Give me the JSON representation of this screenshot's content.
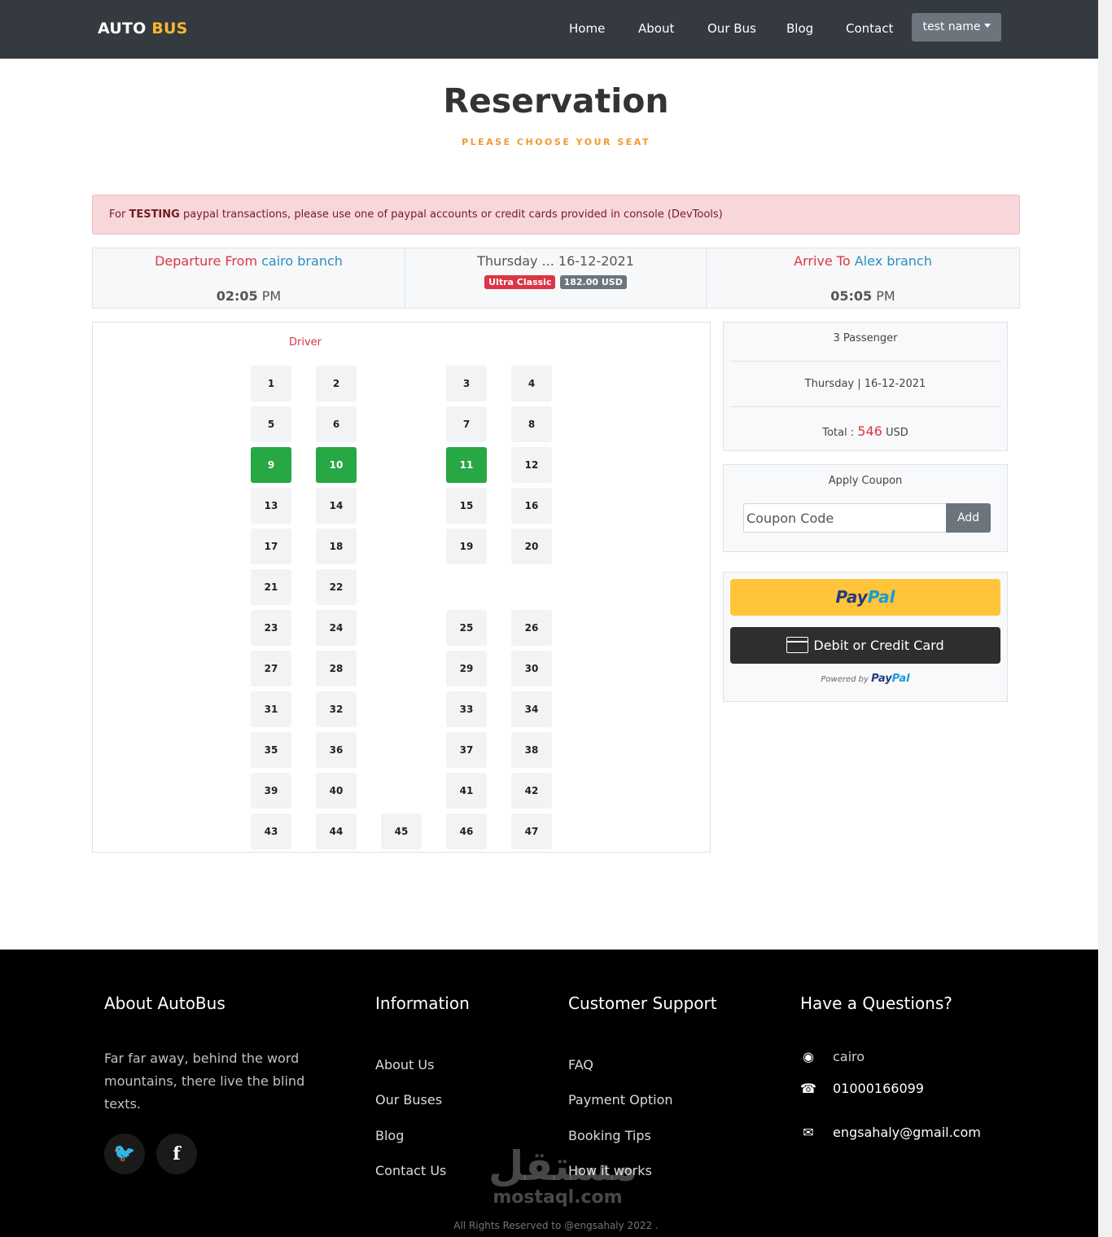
{
  "nav": {
    "brand_part1": "AUTO",
    "brand_part2": "BUS",
    "links": [
      "Home",
      "About",
      "Our Bus",
      "Blog",
      "Contact"
    ],
    "user": "test name"
  },
  "page": {
    "title": "Reservation",
    "subtitle": "PLEASE CHOOSE YOUR SEAT"
  },
  "alert": {
    "prefix": "For",
    "bold": "TESTING",
    "suffix": "paypal transactions, please use one of paypal accounts or credit cards provided in console (DevTools)"
  },
  "trip": {
    "departure_label": "Departure From",
    "departure_branch": "cairo branch",
    "departure_time": "02:05",
    "departure_period": "PM",
    "date": "Thursday ... 16-12-2021",
    "bus_class": "Ultra Classic",
    "price": "182.00 USD",
    "arrival_label": "Arrive To",
    "arrival_branch": "Alex branch",
    "arrival_time": "05:05",
    "arrival_period": "PM"
  },
  "seatmap": {
    "driver_label": "Driver",
    "rows": [
      [
        "1",
        "2",
        "",
        "3",
        "4"
      ],
      [
        "5",
        "6",
        "",
        "7",
        "8"
      ],
      [
        "9",
        "10",
        "",
        "11",
        "12"
      ],
      [
        "13",
        "14",
        "",
        "15",
        "16"
      ],
      [
        "17",
        "18",
        "",
        "19",
        "20"
      ],
      [
        "21",
        "22",
        "",
        "",
        ""
      ],
      [
        "23",
        "24",
        "",
        "25",
        "26"
      ],
      [
        "27",
        "28",
        "",
        "29",
        "30"
      ],
      [
        "31",
        "32",
        "",
        "33",
        "34"
      ],
      [
        "35",
        "36",
        "",
        "37",
        "38"
      ],
      [
        "39",
        "40",
        "",
        "41",
        "42"
      ],
      [
        "43",
        "44",
        "45",
        "46",
        "47"
      ]
    ],
    "selected": [
      "9",
      "10",
      "11"
    ],
    "selected_color": "#28a745"
  },
  "summary": {
    "passengers": "3 Passenger",
    "date": "Thursday | 16-12-2021",
    "total_label": "Total :",
    "total_value": "546",
    "total_currency": "USD"
  },
  "coupon": {
    "title": "Apply Coupon",
    "placeholder": "Coupon Code",
    "button": "Add"
  },
  "payment": {
    "paypal_part1": "Pay",
    "paypal_part2": "Pal",
    "card_button": "Debit or Credit Card",
    "powered_by": "Powered by",
    "powered_brand1": "Pay",
    "powered_brand2": "Pal"
  },
  "footer": {
    "about_heading": "About AutoBus",
    "about_text": "Far far away, behind the word mountains, there live the blind texts.",
    "social": [
      {
        "name": "twitter-icon",
        "glyph": "🐦"
      },
      {
        "name": "facebook-icon",
        "glyph": "f"
      }
    ],
    "info_heading": "Information",
    "info_links": [
      "About Us",
      "Our Buses",
      "Blog",
      "Contact Us"
    ],
    "support_heading": "Customer Support",
    "support_links": [
      "FAQ",
      "Payment Option",
      "Booking Tips",
      "How it works"
    ],
    "questions_heading": "Have a Questions?",
    "address": "cairo",
    "phone": "01000166099",
    "email": "engsahaly@gmail.com",
    "watermark_arabic": "مستقل",
    "watermark_latin": "mostaql.com",
    "copyright": "All Rights Reserved to @engsahaly 2022 ."
  },
  "colors": {
    "navbar": "#343a40",
    "accent": "#f7b731",
    "danger": "#dc3545",
    "link_blue": "#2a8ec1",
    "paypal_yellow": "#ffc439"
  }
}
